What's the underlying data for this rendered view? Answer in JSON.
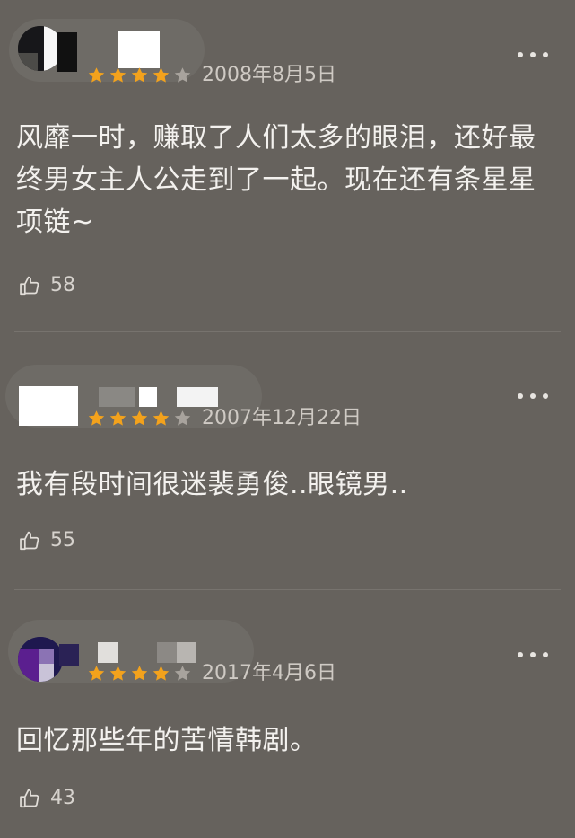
{
  "comments": [
    {
      "rating": 4,
      "date": "2008年8月5日",
      "text": "风靡一时，赚取了人们太多的眼泪，还好最终男女主人公走到了一起。现在还有条星星项链~",
      "likes": "58"
    },
    {
      "rating": 4,
      "date": "2007年12月22日",
      "text": "我有段时间很迷裴勇俊..眼镜男..",
      "likes": "55"
    },
    {
      "rating": 4,
      "date": "2017年4月6日",
      "text": "回忆那些年的苦情韩剧。",
      "likes": "43"
    }
  ],
  "icons": {
    "star": "star-icon",
    "more": "more-icon",
    "like": "thumbs-up-icon"
  },
  "colors": {
    "background": "#66625d",
    "star_filled": "#f3a21c",
    "star_empty": "#a8a39d",
    "text": "#f3f1ee",
    "meta_text": "#cfcac4"
  }
}
